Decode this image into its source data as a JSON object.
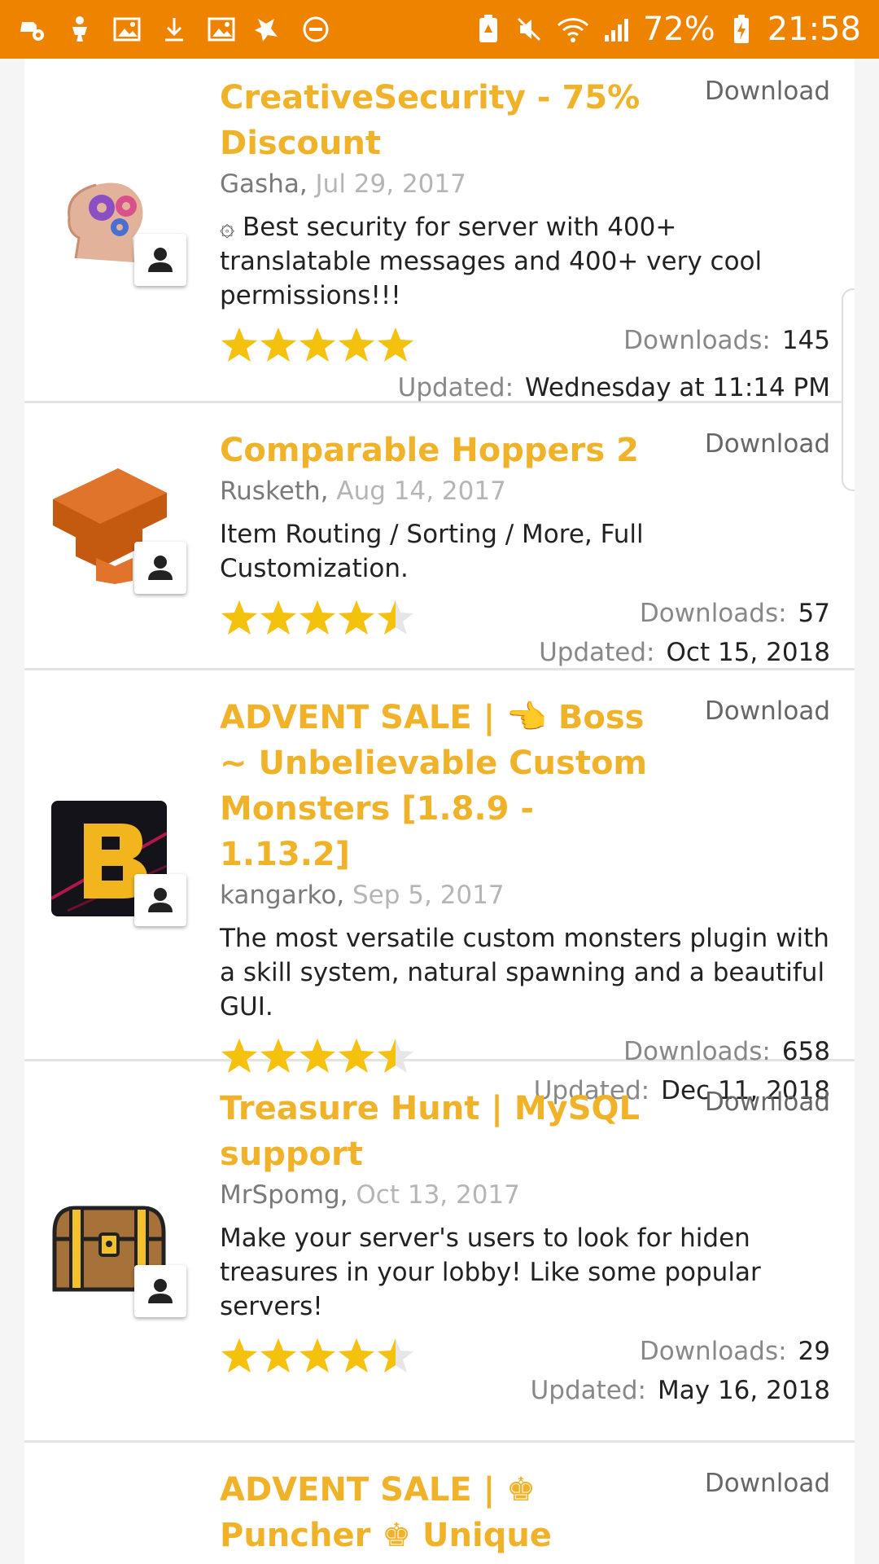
{
  "status_bar": {
    "battery": "72%",
    "time": "21:58"
  },
  "colors": {
    "status_bar": "#ee8300",
    "title": "#f0b228",
    "star": "#f4c20d"
  },
  "labels": {
    "download": "Download",
    "downloads": "Downloads:",
    "updated": "Updated:"
  },
  "resources": [
    {
      "title": "CreativeSecurity - 75% Discount",
      "author": "Gasha,",
      "date": "Jul 29, 2017",
      "description": "۞ Best security for server with 400+ translatable messages and 400+ very cool permissions!!!",
      "rating": 5,
      "downloads": "145",
      "updated": "Wednesday at 11:14 PM",
      "icon": "brain-gears-icon"
    },
    {
      "title": "Comparable Hoppers 2",
      "author": "Rusketh,",
      "date": "Aug 14, 2017",
      "description": "Item Routing / Sorting / More, Full Customization.",
      "rating": 4.5,
      "downloads": "57",
      "updated": "Oct 15, 2018",
      "icon": "hopper-icon"
    },
    {
      "title": "ADVENT SALE | 👈 Boss ~ Unbelievable Custom Monsters [1.8.9 - 1.13.2]",
      "author": "kangarko,",
      "date": "Sep 5, 2017",
      "description": "The most versatile custom monsters plugin with a skill system, natural spawning and a beautiful GUI.",
      "rating": 4.5,
      "downloads": "658",
      "updated": "Dec 11, 2018",
      "icon": "boss-b-logo-icon"
    },
    {
      "title": "Treasure Hunt | MySQL support",
      "author": "MrSpomg,",
      "date": "Oct 13, 2017",
      "description": "Make your server's users to look for hiden treasures in your lobby! Like some popular servers!",
      "rating": 4.5,
      "downloads": "29",
      "updated": "May 16, 2018",
      "icon": "treasure-chest-icon"
    },
    {
      "title": "ADVENT SALE | ♚ Puncher ♚ Unique Family-Friendly",
      "author": "",
      "date": "",
      "description": "",
      "rating": null,
      "downloads": "",
      "updated": "",
      "icon": ""
    }
  ]
}
